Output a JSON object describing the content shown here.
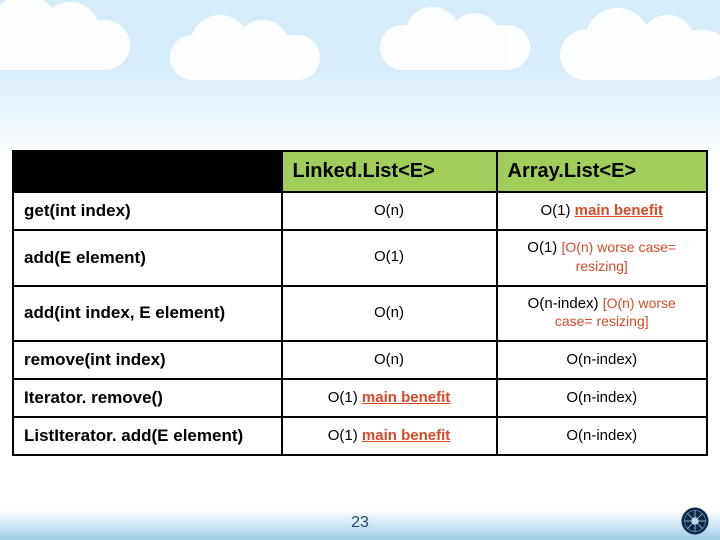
{
  "page_number": "23",
  "table": {
    "headers": [
      "Linked.List<E>",
      "Array.List<E>"
    ],
    "main_benefit": "main benefit",
    "rows": [
      {
        "op": "get(int index)",
        "linked": "O(n)",
        "array_prefix": "O(1)"
      },
      {
        "op": "add(E element)",
        "linked": "O(1)",
        "array_prefix": "O(1)",
        "array_note": "[O(n) worse case= resizing]"
      },
      {
        "op": "add(int index, E element)",
        "linked": "O(n)",
        "array_prefix": "O(n-index)",
        "array_note": "[O(n) worse case= resizing]"
      },
      {
        "op": "remove(int index)",
        "linked": "O(n)",
        "array": "O(n-index)"
      },
      {
        "op": "Iterator. remove()",
        "linked_prefix": "O(1)",
        "array": "O(n-index)"
      },
      {
        "op": "ListIterator. add(E element)",
        "linked_prefix": "O(1)",
        "array": "O(n-index)"
      }
    ]
  }
}
